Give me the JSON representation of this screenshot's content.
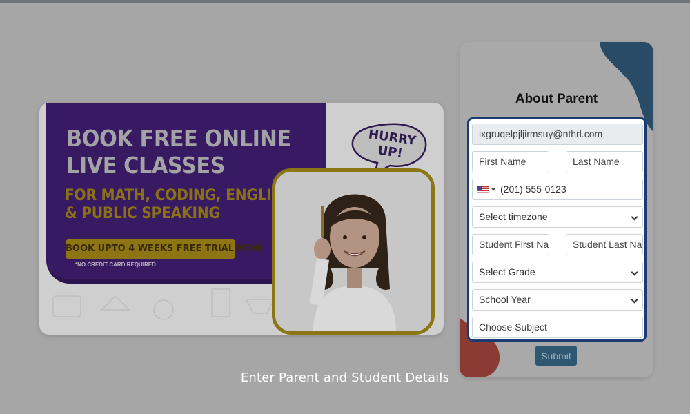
{
  "banner": {
    "headline_line1": "BOOK FREE ONLINE",
    "headline_line2": "LIVE CLASSES",
    "subhead_line1": "FOR MATH, CODING, ENGLISH",
    "subhead_line2": "& PUBLIC SPEAKING",
    "trial_cta": "BOOK UPTO 4 WEEKS FREE TRIAL NOW",
    "no_card_note": "*NO CREDIT CARD REQUIRED",
    "bubble_line1": "HURRY",
    "bubble_line2": "UP!"
  },
  "form": {
    "title": "About Parent",
    "email_value": "ixgruqelpjljirmsuy@nthrl.com",
    "first_name_placeholder": "First Name",
    "last_name_placeholder": "Last Name",
    "phone_value": "(201) 555-0123",
    "timezone_selected": "Select timezone",
    "student_first_placeholder": "Student First Na",
    "student_last_placeholder": "Student Last Na",
    "grade_selected": "Select Grade",
    "school_year_selected": "School Year",
    "subject_placeholder": "Choose Subject",
    "submit_label": "Submit"
  },
  "caption": "Enter Parent and Student Details",
  "colors": {
    "overlay": "#a6a6a6",
    "highlight_border": "#1a3c73",
    "submit": "#2e5872",
    "banner_purple": "#381a63",
    "banner_gold": "#8e7514"
  }
}
